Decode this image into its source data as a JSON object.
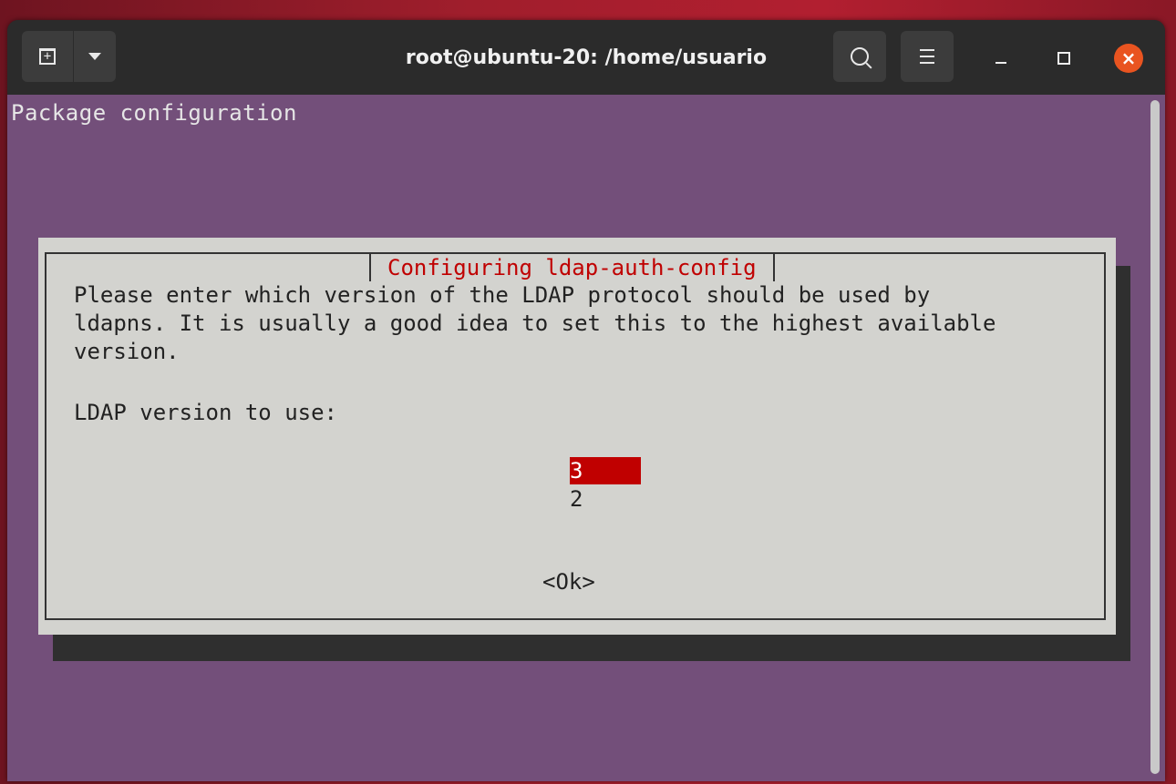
{
  "window": {
    "title": "root@ubuntu-20: /home/usuario"
  },
  "titlebar": {
    "icons": [
      "new-tab-icon",
      "dropdown-caret-icon",
      "search-icon",
      "hamburger-menu-icon",
      "minimize-icon",
      "maximize-icon",
      "close-icon"
    ]
  },
  "terminal": {
    "header_text": "Package configuration"
  },
  "dialog": {
    "title": "Configuring ldap-auth-config",
    "body": "Please enter which version of the LDAP protocol should be used by\nldapns. It is usually a good idea to set this to the highest available\nversion.",
    "prompt": "LDAP version to use:",
    "options": [
      "3",
      "2"
    ],
    "selected_option": "3",
    "ok_label": "<Ok>"
  },
  "colors": {
    "terminal_bg": "#734f7a",
    "dialog_bg": "#d3d3cf",
    "accent_red": "#c00000",
    "close_button": "#e95420"
  }
}
